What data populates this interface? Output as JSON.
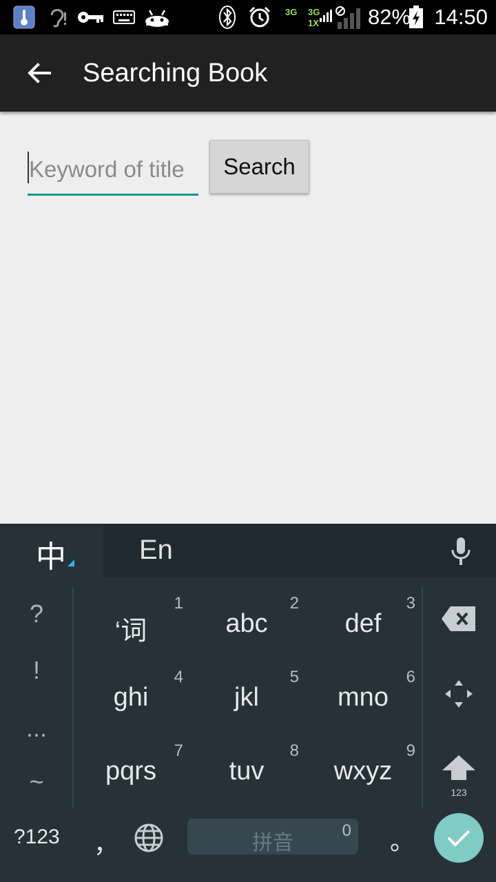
{
  "status_bar": {
    "icons": [
      "thermometer-icon",
      "hearing-icon",
      "key-icon",
      "keyboard-icon",
      "android-icon",
      "bluetooth-icon",
      "alarm-icon",
      "signal-icon",
      "battery-icon"
    ],
    "net1": "3G",
    "net2a": "3G",
    "net2b": "1X",
    "battery": "82%",
    "time": "14:50"
  },
  "app_bar": {
    "title": "Searching Book",
    "back_icon": "back-arrow-icon"
  },
  "search": {
    "placeholder": "Keyword of title",
    "value": "",
    "button_label": "Search"
  },
  "keyboard": {
    "tabs": {
      "zh": "中",
      "en": "En"
    },
    "symbols": [
      "?",
      "!",
      "...",
      "~"
    ],
    "keys": [
      {
        "label": "‘词",
        "num": "1"
      },
      {
        "label": "abc",
        "num": "2"
      },
      {
        "label": "def",
        "num": "3"
      },
      {
        "label": "ghi",
        "num": "4"
      },
      {
        "label": "jkl",
        "num": "5"
      },
      {
        "label": "mno",
        "num": "6"
      },
      {
        "label": "pqrs",
        "num": "7"
      },
      {
        "label": "tuv",
        "num": "8"
      },
      {
        "label": "wxyz",
        "num": "9"
      }
    ],
    "shift_label": "123",
    "bottom": {
      "num_mode": "?123",
      "comma": "，",
      "space_label": "拼音",
      "space_num": "0",
      "period": "。"
    },
    "accent_color": "#80cbc4"
  }
}
